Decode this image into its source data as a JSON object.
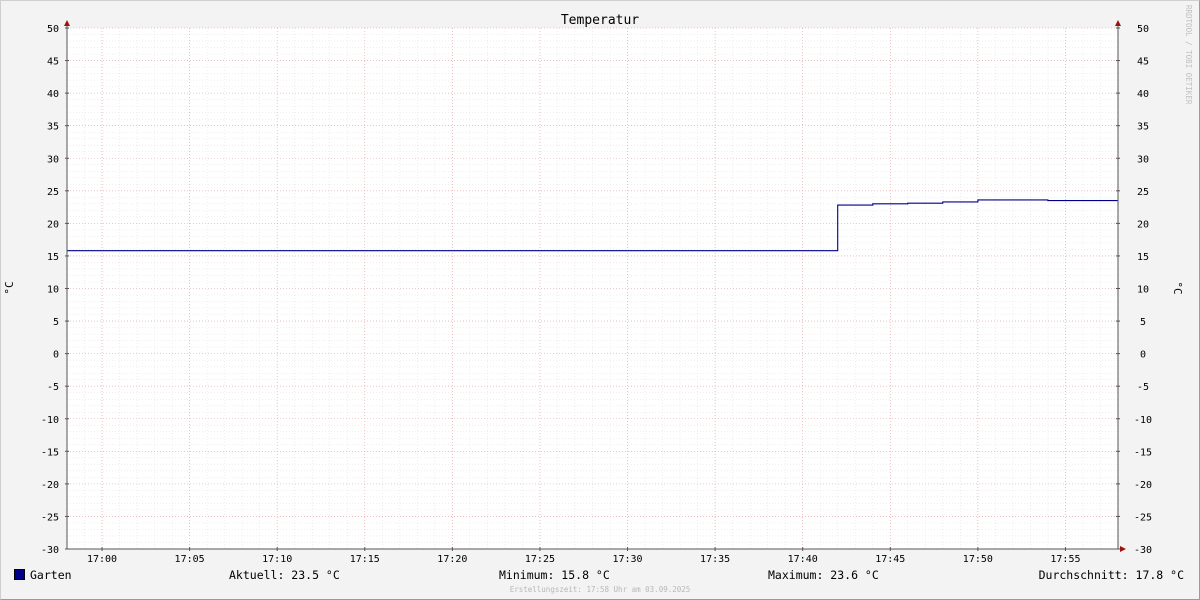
{
  "chart_data": {
    "type": "line",
    "title": "Temperatur",
    "ylabel": "°C",
    "ylabel_right": "°C",
    "ylim": [
      -30,
      50
    ],
    "yticks": [
      50,
      45,
      40,
      35,
      30,
      25,
      20,
      15,
      10,
      5,
      0,
      -5,
      -10,
      -15,
      -20,
      -25,
      -30
    ],
    "xlim": [
      "16:58",
      "17:58"
    ],
    "xticks": [
      "17:00",
      "17:05",
      "17:10",
      "17:15",
      "17:20",
      "17:25",
      "17:30",
      "17:35",
      "17:40",
      "17:45",
      "17:50",
      "17:55"
    ],
    "grid": true,
    "legend_placement": "bottom-left",
    "series": [
      {
        "name": "Garten",
        "color": "#00008b",
        "x": [
          "16:58",
          "17:42",
          "17:42",
          "17:44",
          "17:44",
          "17:46",
          "17:46",
          "17:48",
          "17:48",
          "17:50",
          "17:50",
          "17:54",
          "17:54",
          "17:58"
        ],
        "values": [
          15.8,
          15.8,
          22.8,
          22.8,
          23.0,
          23.0,
          23.1,
          23.1,
          23.3,
          23.3,
          23.6,
          23.6,
          23.5,
          23.5
        ]
      }
    ]
  },
  "legend": {
    "series_name": "Garten",
    "aktuell": "Aktuell: 23.5 °C",
    "minimum": "Minimum: 15.8 °C",
    "maximum": "Maximum: 23.6 °C",
    "durchschnitt": "Durchschnitt: 17.8 °C"
  },
  "watermark": "RRDTOOL / TOBI OETIKER",
  "footer": "Erstellungszeit: 17:58 Uhr am 03.09.2025"
}
